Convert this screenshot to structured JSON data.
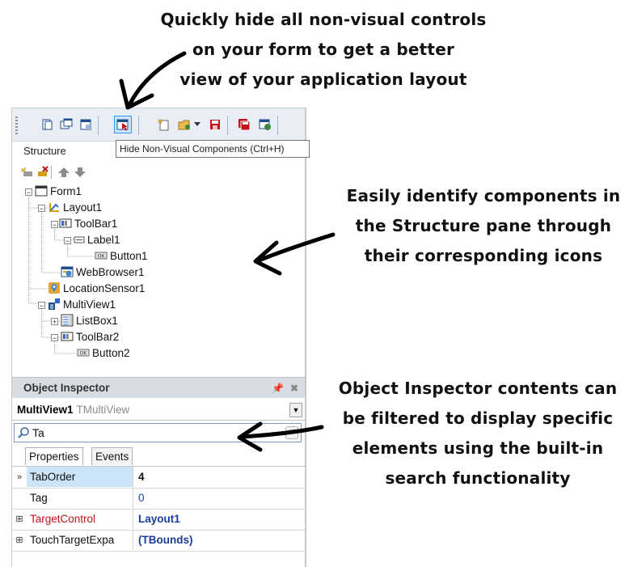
{
  "annotations": {
    "top": [
      "Quickly hide all non-visual controls",
      "on your form to get a better",
      "view of your application layout"
    ],
    "middle": [
      "Easily identify components in",
      "the Structure pane through",
      "their corresponding icons"
    ],
    "bottom": [
      "Object Inspector contents can",
      "be filtered  to display specific",
      "elements using the built-in",
      "search functionality"
    ]
  },
  "tooltip": "Hide Non-Visual Components (Ctrl+H)",
  "structure": {
    "tab_label": "Structure",
    "tree": [
      {
        "label": "Form1",
        "icon": "form-icon"
      },
      {
        "label": "Layout1",
        "icon": "layout-icon"
      },
      {
        "label": "ToolBar1",
        "icon": "toolbar-icon"
      },
      {
        "label": "Label1",
        "icon": "label-icon"
      },
      {
        "label": "Button1",
        "icon": "button-icon"
      },
      {
        "label": "WebBrowser1",
        "icon": "webbrowser-icon"
      },
      {
        "label": "LocationSensor1",
        "icon": "location-sensor-icon"
      },
      {
        "label": "MultiView1",
        "icon": "multiview-icon"
      },
      {
        "label": "ListBox1",
        "icon": "listbox-icon"
      },
      {
        "label": "ToolBar2",
        "icon": "toolbar-icon"
      },
      {
        "label": "Button2",
        "icon": "button-icon"
      }
    ]
  },
  "inspector": {
    "title": "Object Inspector",
    "selected_name": "MultiView1",
    "selected_class": "TMultiView",
    "search_value": "Ta",
    "tabs": [
      "Properties",
      "Events"
    ],
    "properties": [
      {
        "name": "TabOrder",
        "value": "4"
      },
      {
        "name": "Tag",
        "value": "0"
      },
      {
        "name": "TargetControl",
        "value": "Layout1"
      },
      {
        "name": "TouchTargetExpa",
        "value": "(TBounds)"
      }
    ]
  },
  "colors": {
    "toolbar_bg": "#e9eef6",
    "selection": "#cce4f7",
    "value_blue": "#1a3b9a",
    "reference_red": "#c2121a"
  }
}
